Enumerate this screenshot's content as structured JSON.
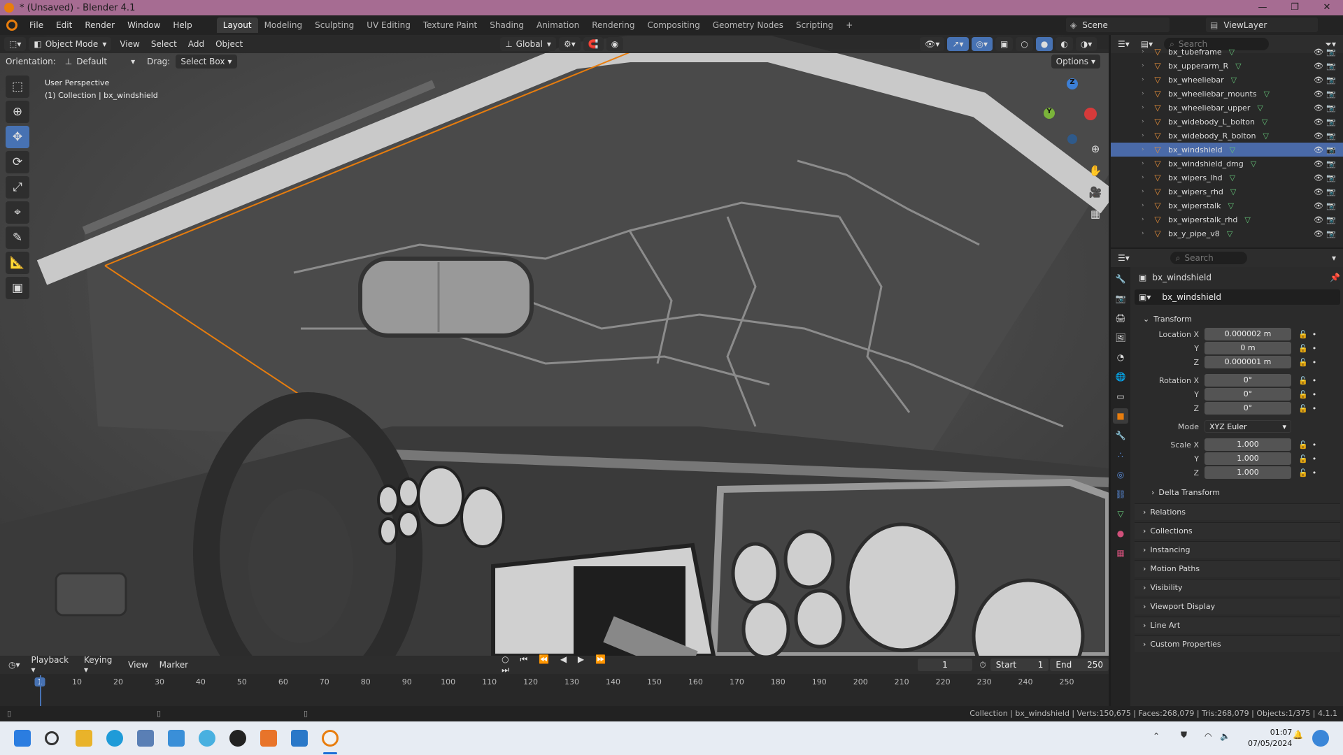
{
  "title_bar": {
    "title": "* (Unsaved) - Blender 4.1",
    "min": "—",
    "max": "❐",
    "close": "✕"
  },
  "menu": [
    "File",
    "Edit",
    "Render",
    "Window",
    "Help"
  ],
  "workspaces": [
    "Layout",
    "Modeling",
    "Sculpting",
    "UV Editing",
    "Texture Paint",
    "Shading",
    "Animation",
    "Rendering",
    "Compositing",
    "Geometry Nodes",
    "Scripting"
  ],
  "workspace_add": "+",
  "scene": "Scene",
  "view_layer": "ViewLayer",
  "viewport": {
    "mode": "Object Mode",
    "menus": [
      "View",
      "Select",
      "Add",
      "Object"
    ],
    "transform": "Global",
    "orientation_label": "Orientation:",
    "orientation_value": "Default",
    "drag_label": "Drag:",
    "drag_value": "Select Box",
    "options": "Options",
    "perspective": "User Perspective",
    "collection_info": "(1) Collection | bx_windshield",
    "gizmo": {
      "z": "Z",
      "y": "Y"
    }
  },
  "outliner": {
    "search_placeholder": "Search",
    "items": [
      {
        "name": "bx_tubeframe",
        "selected": false
      },
      {
        "name": "bx_upperarm_R",
        "selected": false
      },
      {
        "name": "bx_wheeliebar",
        "selected": false
      },
      {
        "name": "bx_wheeliebar_mounts",
        "selected": false
      },
      {
        "name": "bx_wheeliebar_upper",
        "selected": false
      },
      {
        "name": "bx_widebody_L_bolton",
        "selected": false
      },
      {
        "name": "bx_widebody_R_bolton",
        "selected": false
      },
      {
        "name": "bx_windshield",
        "selected": true
      },
      {
        "name": "bx_windshield_dmg",
        "selected": false
      },
      {
        "name": "bx_wipers_lhd",
        "selected": false
      },
      {
        "name": "bx_wipers_rhd",
        "selected": false
      },
      {
        "name": "bx_wiperstalk",
        "selected": false
      },
      {
        "name": "bx_wiperstalk_rhd",
        "selected": false
      },
      {
        "name": "bx_y_pipe_v8",
        "selected": false
      }
    ]
  },
  "properties": {
    "search_placeholder": "Search",
    "object_name": "bx_windshield",
    "data_name": "bx_windshield",
    "transform_header": "Transform",
    "location": {
      "label_x": "Location X",
      "x": "0.000002 m",
      "y": "0 m",
      "z": "0.000001 m"
    },
    "rotation": {
      "label_x": "Rotation X",
      "x": "0°",
      "y": "0°",
      "z": "0°"
    },
    "mode_label": "Mode",
    "mode_value": "XYZ Euler",
    "scale": {
      "label_x": "Scale X",
      "x": "1.000",
      "y": "1.000",
      "z": "1.000"
    },
    "axis_y": "Y",
    "axis_z": "Z",
    "delta": "Delta Transform",
    "panels": [
      "Relations",
      "Collections",
      "Instancing",
      "Motion Paths",
      "Visibility",
      "Viewport Display",
      "Line Art",
      "Custom Properties"
    ]
  },
  "timeline": {
    "menus": [
      "Playback",
      "Keying",
      "View",
      "Marker"
    ],
    "current_frame": "1",
    "start_label": "Start",
    "start": "1",
    "end_label": "End",
    "end": "250",
    "ruler": [
      "1",
      "10",
      "20",
      "30",
      "40",
      "50",
      "60",
      "70",
      "80",
      "90",
      "100",
      "110",
      "120",
      "130",
      "140",
      "150",
      "160",
      "170",
      "180",
      "190",
      "200",
      "210",
      "220",
      "230",
      "240",
      "250"
    ]
  },
  "status": "Collection | bx_windshield | Verts:150,675 | Faces:268,079 | Tris:268,079 | Objects:1/375 | 4.1.1",
  "taskbar": {
    "time": "01:07",
    "date": "07/05/2024"
  },
  "colors": {
    "accent": "#4772b3",
    "selection_outline": "#e87d0d",
    "title_bar": "#a66c92"
  }
}
